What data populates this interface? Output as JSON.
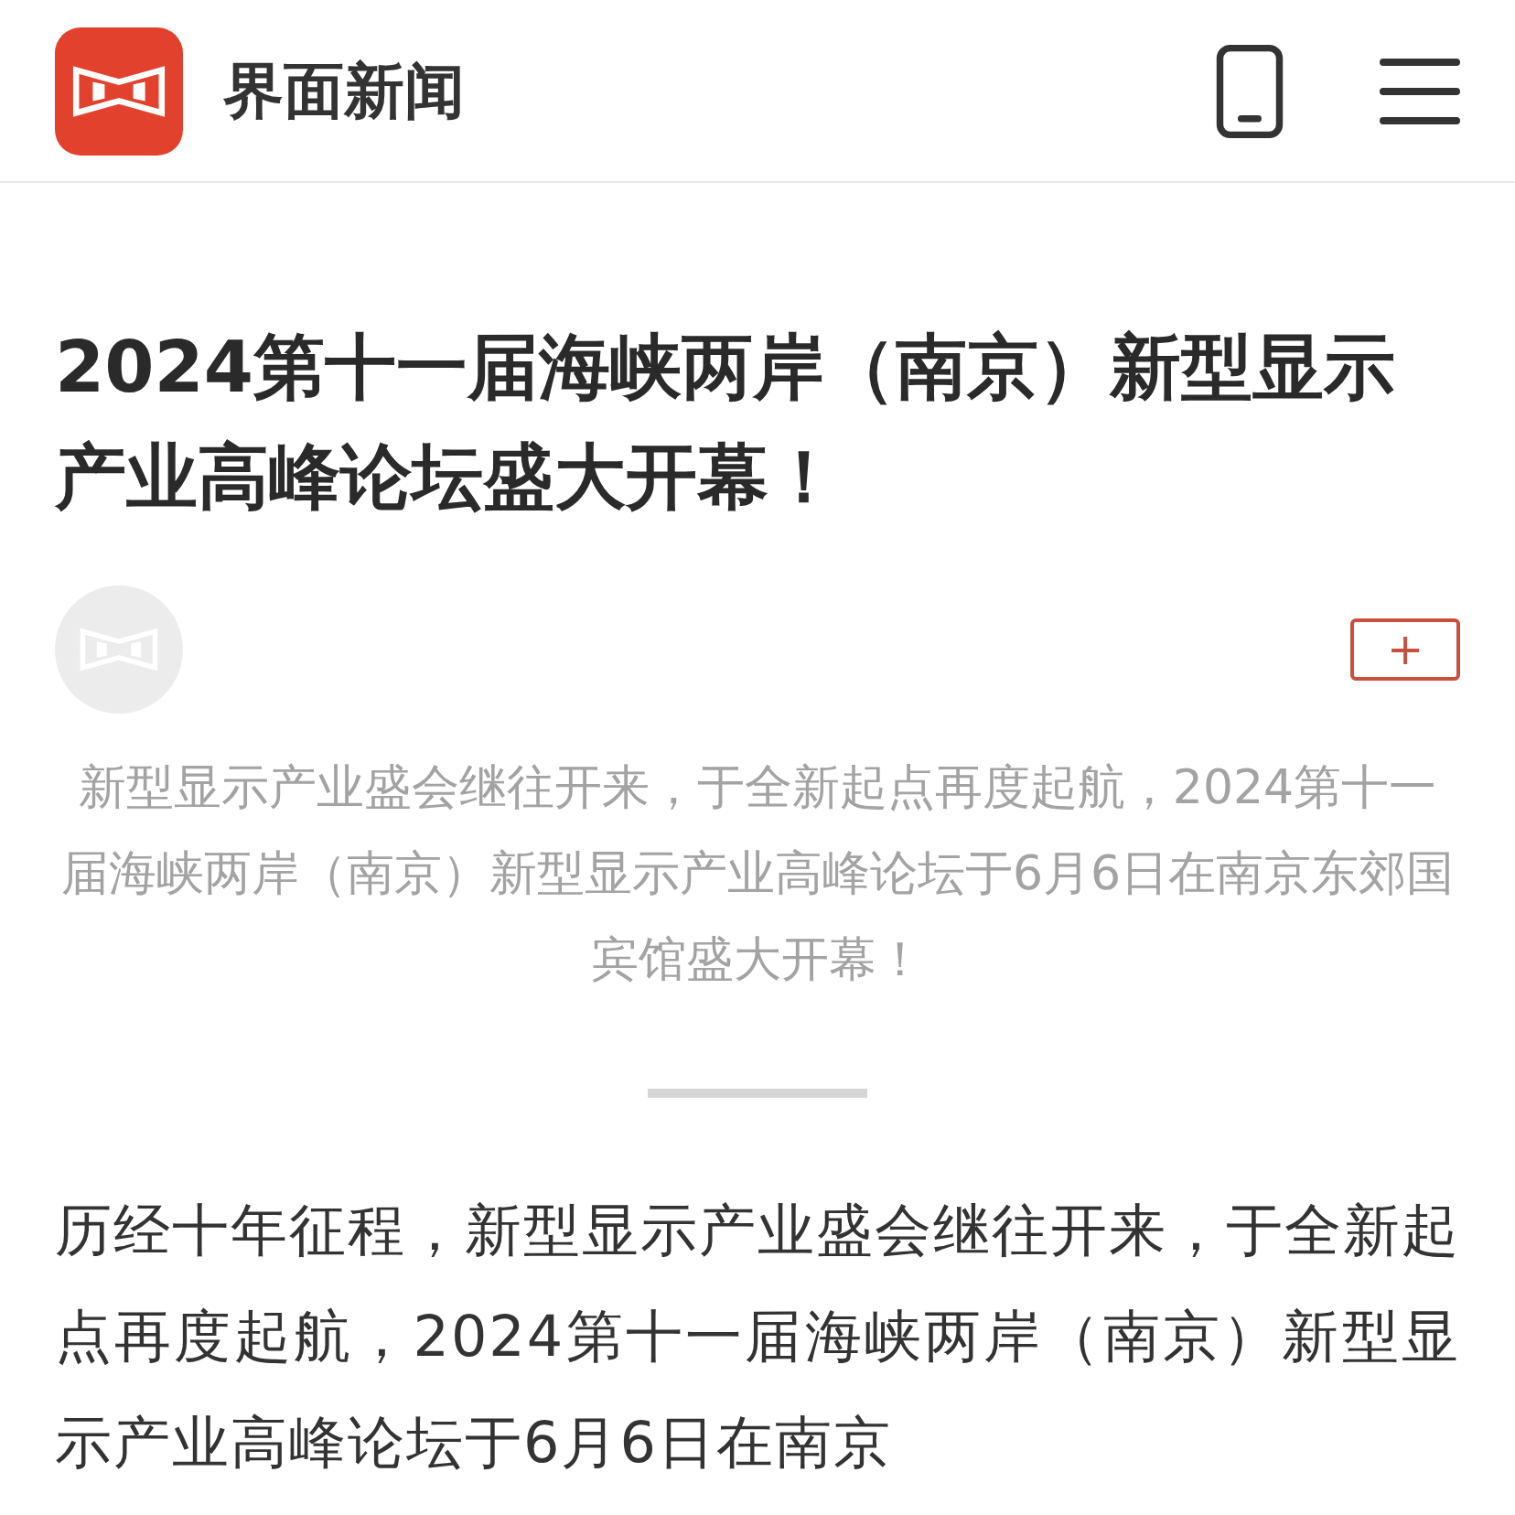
{
  "header": {
    "brand": "界面新闻"
  },
  "article": {
    "headline": "2024第十一届海峡两岸（南京）新型显示产业高峰论坛盛大开幕！",
    "follow_button": "+",
    "summary": "新型显示产业盛会继往开来，于全新起点再度起航，2024第十一届海峡两岸（南京）新型显示产业高峰论坛于6月6日在南京东郊国宾馆盛大开幕！",
    "body": "历经十年征程，新型显示产业盛会继往开来，于全新起点再度起航，2024第十一届海峡两岸（南京）新型显示产业高峰论坛于6月6日在南京"
  }
}
